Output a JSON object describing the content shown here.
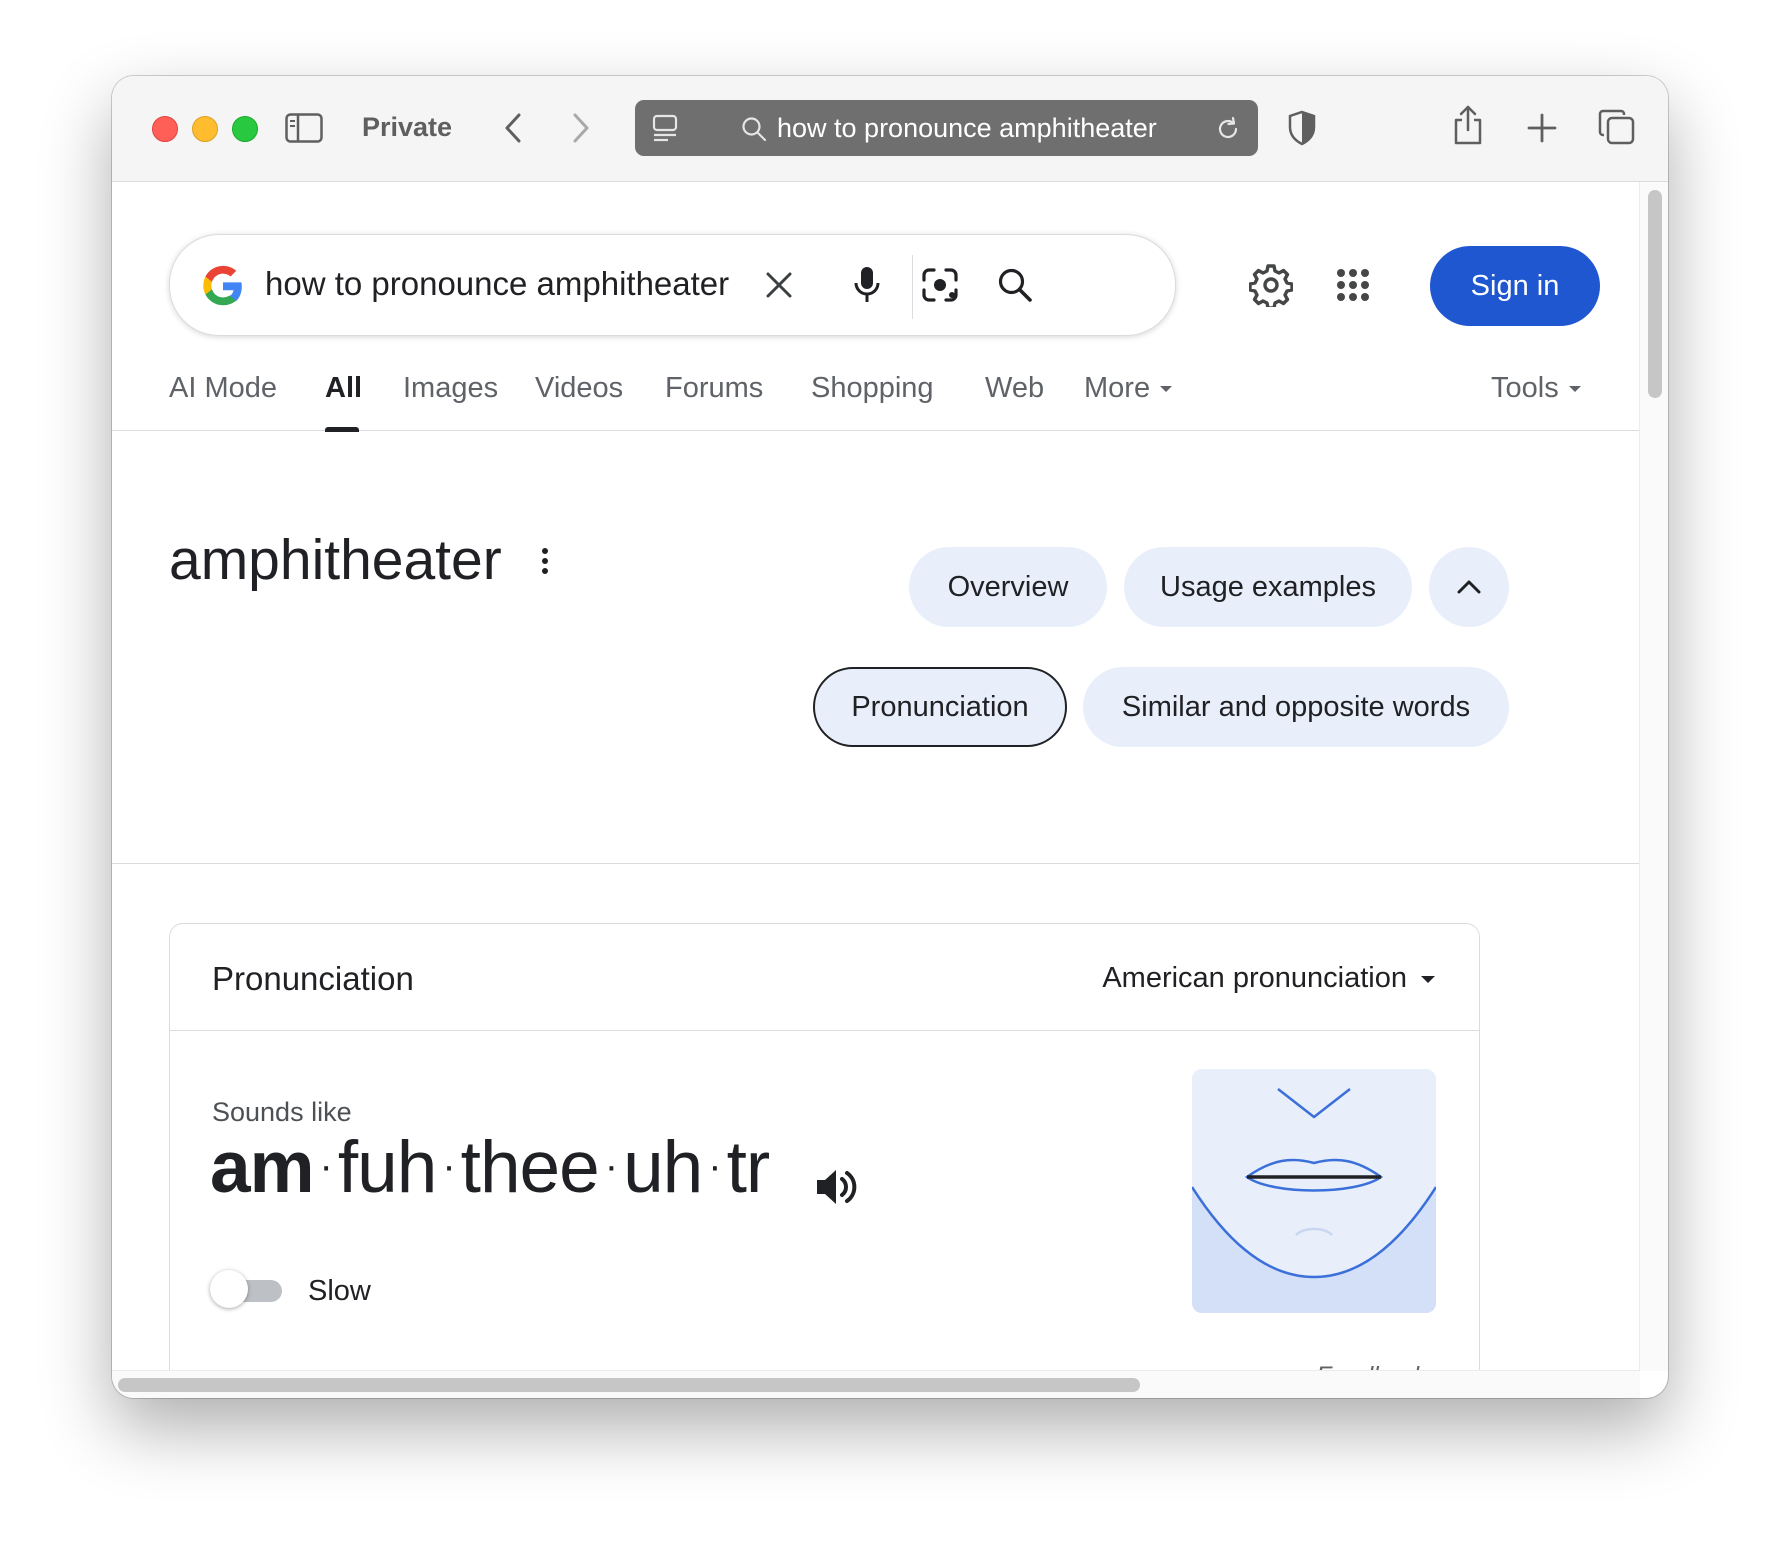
{
  "browser": {
    "mode_label": "Private",
    "url_text": "how to pronounce amphitheater"
  },
  "search": {
    "query": "how to pronounce amphitheater",
    "sign_in_label": "Sign in"
  },
  "tabs": [
    {
      "label": "AI Mode"
    },
    {
      "label": "All",
      "active": true
    },
    {
      "label": "Images"
    },
    {
      "label": "Videos"
    },
    {
      "label": "Forums"
    },
    {
      "label": "Shopping"
    },
    {
      "label": "Web"
    },
    {
      "label": "More"
    }
  ],
  "tools_label": "Tools",
  "dictionary": {
    "word": "amphitheater",
    "chips": {
      "overview": "Overview",
      "usage": "Usage examples",
      "pronunciation": "Pronunciation",
      "similar": "Similar and opposite words"
    }
  },
  "pronunciation_card": {
    "title": "Pronunciation",
    "accent": "American pronunciation",
    "sounds_like_label": "Sounds like",
    "syllables": [
      "am",
      "fuh",
      "thee",
      "uh",
      "tr"
    ],
    "separator": "·",
    "slow_label": "Slow",
    "slow_enabled": false,
    "feedback_label": "Feedback"
  },
  "colors": {
    "accent_blue": "#1f57d1",
    "chip_bg": "#e8effb",
    "illustration_line": "#3b6fd9"
  }
}
